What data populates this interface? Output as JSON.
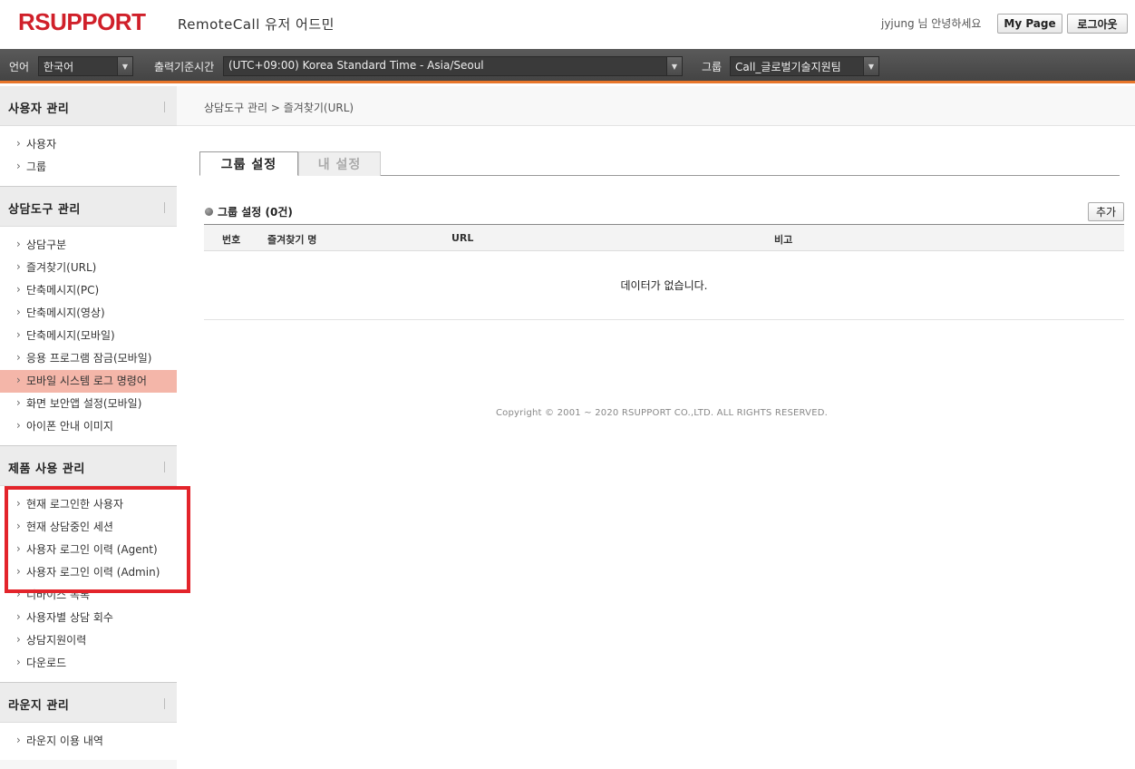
{
  "header": {
    "logo_text": "RSUPPORT",
    "app_title": "RemoteCall 유저 어드민",
    "greeting": "jyjung 님 안녕하세요",
    "mypage_label": "My Page",
    "logout_label": "로그아웃",
    "brand_color": "#d0202a"
  },
  "toolbar": {
    "language_label": "언어",
    "language_value": "한국어",
    "timezone_label": "출력기준시간",
    "timezone_value": "(UTC+09:00) Korea Standard Time - Asia/Seoul",
    "group_label": "그룹",
    "group_value": "Call_글로벌기술지원팀",
    "accent_color": "#e8762b"
  },
  "sidebar": {
    "sections": [
      {
        "title": "사용자 관리",
        "items": [
          "사용자",
          "그룹"
        ]
      },
      {
        "title": "상담도구 관리",
        "items": [
          "상담구분",
          "즐겨찾기(URL)",
          "단축메시지(PC)",
          "단축메시지(영상)",
          "단축메시지(모바일)",
          "응용 프로그램 잠금(모바일)",
          "모바일 시스템 로그 명령어",
          "화면 보안앱 설정(모바일)",
          "아이폰 안내 이미지"
        ]
      },
      {
        "title": "제품 사용 관리",
        "items": [
          "현재 로그인한 사용자",
          "현재 상담중인 세션",
          "사용자 로그인 이력 (Agent)",
          "사용자 로그인 이력 (Admin)",
          "디바이스 목록",
          "사용자별 상담 회수",
          "상담지원이력",
          "다운로드"
        ]
      },
      {
        "title": "라운지 관리",
        "items": [
          "라운지 이용 내역"
        ]
      }
    ],
    "active_item": "모바일 시스템 로그 명령어"
  },
  "main": {
    "breadcrumb": "상담도구 관리 > 즐겨찾기(URL)",
    "tabs": [
      {
        "label": "그룹 설정",
        "active": true
      },
      {
        "label": "내 설정",
        "active": false
      }
    ],
    "section_title": "그룹 설정 (0건)",
    "add_label": "추가",
    "columns": [
      "번호",
      "즐겨찾기 명",
      "URL",
      "비고"
    ],
    "empty_message": "데이터가 없습니다.",
    "copyright": "Copyright © 2001 ~ 2020 RSUPPORT CO.,LTD. ALL RIGHTS RESERVED."
  }
}
